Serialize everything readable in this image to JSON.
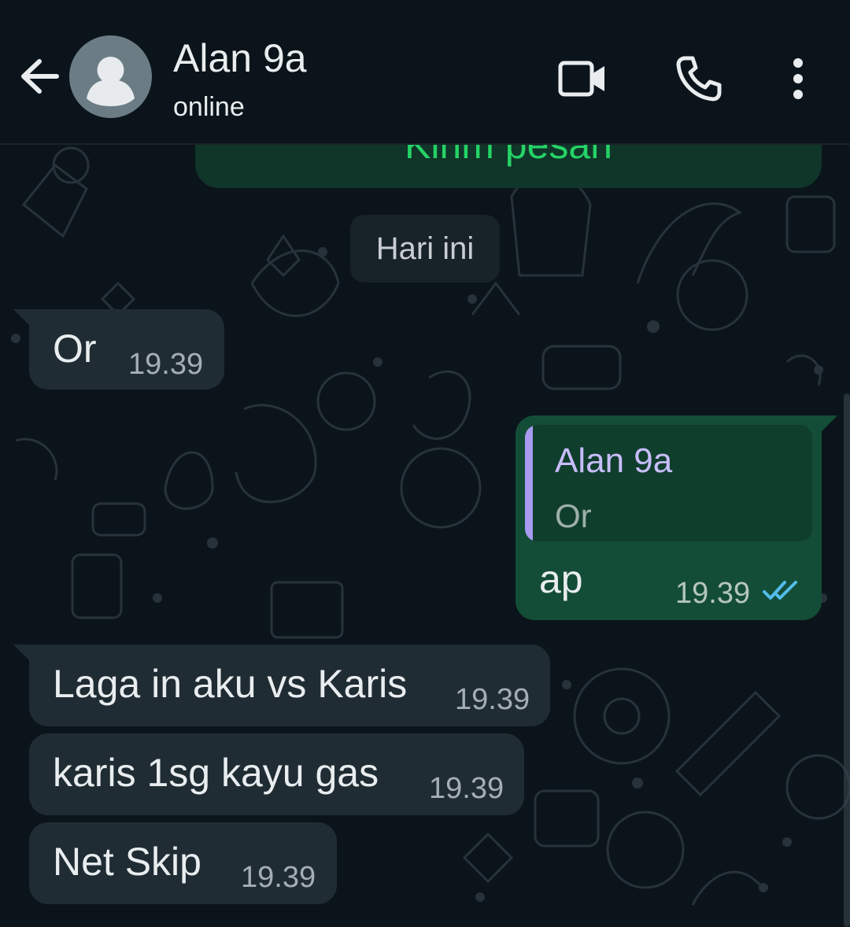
{
  "header": {
    "contact_name": "Alan 9a",
    "status": "online"
  },
  "banner": {
    "text": "Kirim pesan"
  },
  "date_chip": "Hari ini",
  "messages": [
    {
      "direction": "in",
      "text": "Or",
      "time": "19.39"
    },
    {
      "direction": "out",
      "quoted_name": "Alan 9a",
      "quoted_text": "Or",
      "text": "ap",
      "time": "19.39",
      "status": "read"
    },
    {
      "direction": "in",
      "text": "Laga in aku vs Karis",
      "time": "19.39"
    },
    {
      "direction": "in",
      "text": "karis 1sg kayu gas",
      "time": "19.39"
    },
    {
      "direction": "in",
      "text": "Net Skip",
      "time": "19.39"
    }
  ],
  "icons": {
    "back": "arrow-left-icon",
    "avatar": "person-icon",
    "video": "video-camera-icon",
    "call": "phone-icon",
    "menu": "more-vertical-icon",
    "read": "double-check-icon"
  },
  "colors": {
    "background": "#0b141a",
    "incoming_bubble": "#202c33",
    "outgoing_bubble": "#144d37",
    "accent_green": "#25d366",
    "read_check": "#53bdeb",
    "quote_bar": "#a99bf2"
  }
}
